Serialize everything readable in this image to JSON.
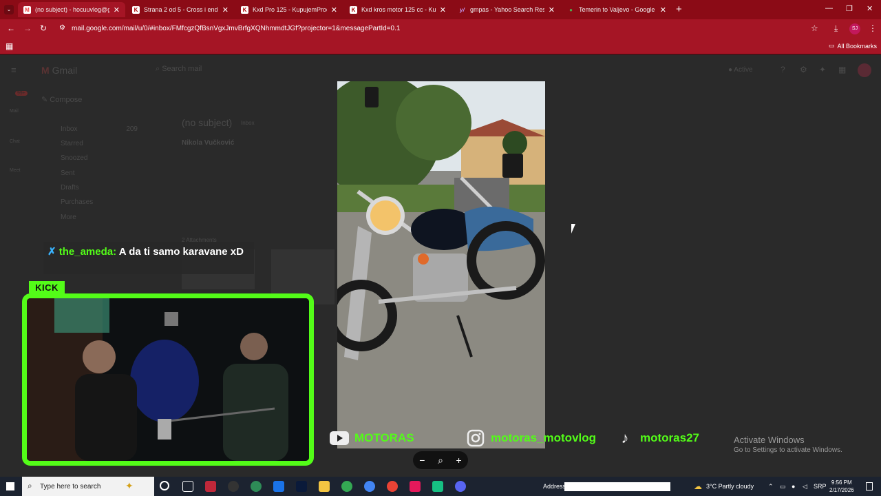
{
  "browser": {
    "tabs": [
      {
        "title": "(no subject) - hocuuvlog@gma",
        "icon": "gmail-icon",
        "active": true
      },
      {
        "title": "Strana 2 od 5 - Cross i enduro",
        "icon": "kp-icon",
        "active": false
      },
      {
        "title": "Kxd Pro 125 - KupujemProdaje",
        "icon": "kp-icon",
        "active": false
      },
      {
        "title": "Kxd kros motor 125 cc - Kupuje",
        "icon": "kp-icon",
        "active": false
      },
      {
        "title": "gmpas - Yahoo Search Results",
        "icon": "yahoo-icon",
        "active": false
      },
      {
        "title": "Temerin to Valjevo - Google Ma",
        "icon": "maps-icon",
        "active": false
      }
    ],
    "url": "mail.google.com/mail/u/0/#inbox/FMfcgzQfBsnVgxJmvBrfgXQNhmmdtJGf?projector=1&messagePartId=0.1",
    "all_bookmarks": "All Bookmarks",
    "profile_initials": "SJ"
  },
  "gmail": {
    "app_name": "Gmail",
    "search_placeholder": "Search mail",
    "compose": "Compose",
    "status": "Active",
    "mail_badge": "99+",
    "rail": [
      "Mail",
      "Chat",
      "Meet"
    ],
    "folders": [
      {
        "label": "Inbox",
        "count": "209"
      },
      {
        "label": "Starred",
        "count": ""
      },
      {
        "label": "Snoozed",
        "count": ""
      },
      {
        "label": "Sent",
        "count": ""
      },
      {
        "label": "Drafts",
        "count": ""
      },
      {
        "label": "Purchases",
        "count": ""
      },
      {
        "label": "More",
        "count": ""
      }
    ],
    "subject": "(no subject)",
    "subject_tag": "Inbox",
    "sender": "Nikola Vučković",
    "attachments_label": "2 Attachments"
  },
  "stream": {
    "platform_badge": "KICK",
    "chat_user": "the_ameda:",
    "chat_message": "A da ti samo karavane xD",
    "socials": [
      {
        "icon": "youtube-icon",
        "handle": "MOTORAS"
      },
      {
        "icon": "instagram-icon",
        "handle": "motoras_motovlog"
      },
      {
        "icon": "tiktok-icon",
        "handle": "motoras27"
      }
    ]
  },
  "viewer": {
    "zoom_out": "−",
    "zoom_in": "+"
  },
  "watermark": {
    "title": "Activate Windows",
    "subtitle": "Go to Settings to activate Windows."
  },
  "taskbar": {
    "search_placeholder": "Type here to search",
    "address_label": "Address",
    "weather": "3°C  Partly cloudy",
    "language": "SRP",
    "time": "9:56 PM",
    "date": "2/17/2026"
  },
  "colors": {
    "kick_green": "#53fc18",
    "chrome_red": "#a51525"
  }
}
